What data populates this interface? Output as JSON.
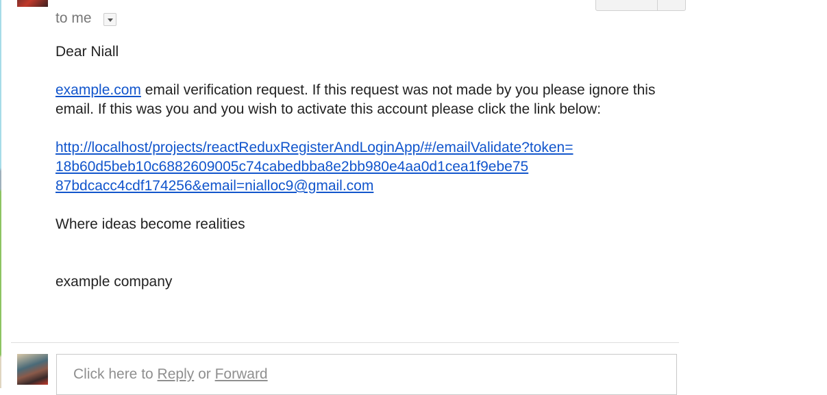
{
  "header": {
    "recipient_label": "to me"
  },
  "email": {
    "greeting": "Dear Niall",
    "intro_link": "example.com",
    "intro_text": " email verification request. If this request was not made by you please ignore this email. If this was you and you wish to activate this account please click the link below:",
    "verify_link_lines": [
      "http://localhost/projects/reactReduxRegisterAndLoginApp/#/emailValidate?token=",
      "18b60d5beb10c6882609005c74cabedbba8e2bb980e4aa0d1cea1f9ebe75",
      "87bdcacc4cdf174256&email=nialloc9@gmail.com"
    ],
    "tagline": "Where ideas become realities",
    "signature": "example company"
  },
  "reply_box": {
    "prefix": "Click here to ",
    "reply": "Reply",
    "or": " or ",
    "forward": "Forward"
  }
}
